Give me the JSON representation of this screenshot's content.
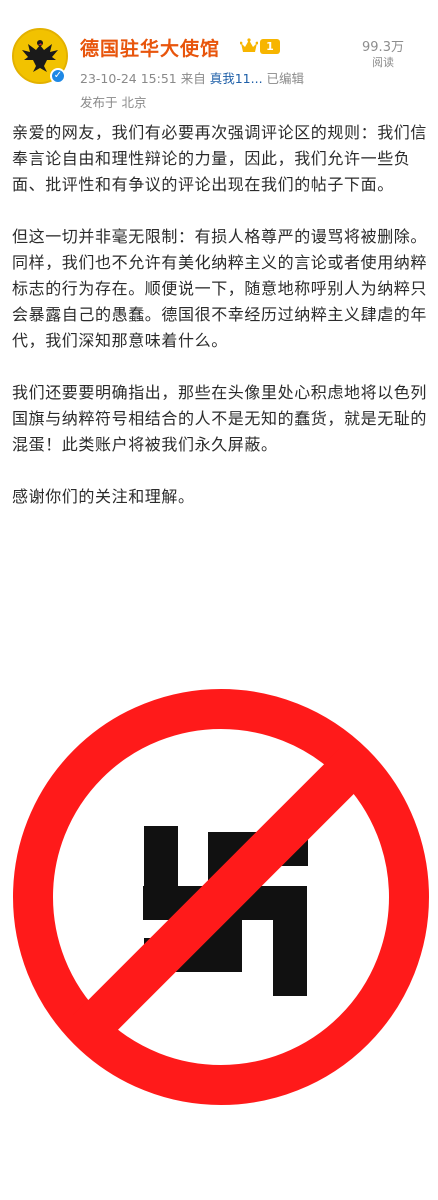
{
  "post": {
    "author": "德国驻华大使馆",
    "level": "1",
    "views": {
      "count": "99.3万",
      "label": "阅读"
    },
    "timestamp": "23-10-24 15:51",
    "source_prefix": "来自",
    "source_name": "真我11...",
    "edited": "已编辑",
    "location": "发布于 北京",
    "paragraphs": [
      "亲爱的网友，我们有必要再次强调评论区的规则：我们信奉言论自由和理性辩论的力量，因此，我们允许一些负面、批评性和有争议的评论出现在我们的帖子下面。",
      "但这一切并非毫无限制：有损人格尊严的谩骂将被删除。同样，我们也不允许有美化纳粹主义的言论或者使用纳粹标志的行为存在。顺便说一下，随意地称呼别人为纳粹只会暴露自己的愚蠢。德国很不幸经历过纳粹主义肆虐的年代，我们深知那意味着什么。",
      "我们还要要明确指出，那些在头像里处心积虑地将以色列国旗与纳粹符号相结合的人不是无知的蠢货，就是无耻的混蛋！此类账户将被我们永久屏蔽。",
      "感谢你们的关注和理解。"
    ]
  },
  "colors": {
    "author": "#e8550c",
    "prohibition_red": "#ff1a1a",
    "symbol": "#111111",
    "link": "#1e5fa8",
    "meta": "#8a8a8a"
  },
  "icons": {
    "avatar": "eagle-crest-icon",
    "verified": "verified-check-icon",
    "level_crown": "crown-icon",
    "image": "prohibited-swastika-symbol"
  }
}
